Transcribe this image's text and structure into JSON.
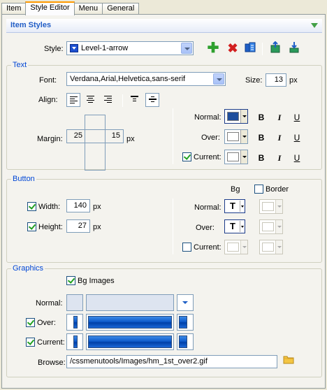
{
  "tabs": [
    "Item",
    "Style Editor",
    "Menu",
    "General"
  ],
  "header": {
    "title": "Item Styles"
  },
  "style": {
    "label": "Style:",
    "value": "Level-1-arrow",
    "swatch_color": "#1c4fd0",
    "icons": [
      "add-icon",
      "delete-icon",
      "copy-icon",
      "export-icon",
      "import-icon"
    ]
  },
  "text_group": {
    "title": "Text",
    "font_label": "Font:",
    "font_value": "Verdana,Arial,Helvetica,sans-serif",
    "size_label": "Size:",
    "size_value": "13",
    "size_unit": "px",
    "align_label": "Align:",
    "margin_label": "Margin:",
    "margin_left": "25",
    "margin_right": "15",
    "margin_unit": "px",
    "states": [
      {
        "label": "Normal:",
        "color": "#1f4e9c",
        "checkbox": false
      },
      {
        "label": "Over:",
        "color": "#ffffff",
        "checkbox": false
      },
      {
        "label": "Current:",
        "color": "#ffffff",
        "checkbox": true,
        "checked": true
      }
    ],
    "bold_label": "B",
    "italic_label": "I",
    "underline_label": "U"
  },
  "button_group": {
    "title": "Button",
    "width_label": "Width:",
    "width_value": "140",
    "height_label": "Height:",
    "height_value": "27",
    "unit": "px",
    "bg_header": "Bg",
    "border_header": "Border",
    "normal_label": "Normal:",
    "over_label": "Over:",
    "current_label": "Current:",
    "transparent_glyph": "T"
  },
  "graphics_group": {
    "title": "Graphics",
    "bg_images_label": "Bg Images",
    "normal_label": "Normal:",
    "over_label": "Over:",
    "current_label": "Current:",
    "browse_label": "Browse:",
    "browse_value": "/cssmenutools/Images/hm_1st_over2.gif"
  },
  "colors": {
    "accent": "#215dc6",
    "group_title": "#0046d5",
    "tab_highlight": "#ff9900"
  }
}
